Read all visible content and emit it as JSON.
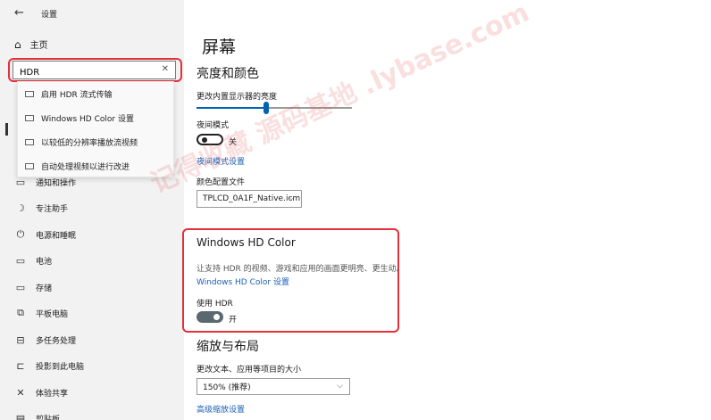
{
  "titlebar": {
    "back_icon": "back-arrow-icon",
    "title": "设置"
  },
  "sidebar": {
    "home_label": "主页",
    "search": {
      "value": "HDR",
      "clear_icon": "close-icon"
    },
    "suggestions": [
      {
        "label": "启用 HDR 流式传输"
      },
      {
        "label": "Windows HD Color 设置"
      },
      {
        "label": "以较低的分辨率播放流视频"
      },
      {
        "label": "自动处理视频以进行改进"
      }
    ],
    "items": [
      {
        "label": "通知和操作",
        "icon": "notification-icon"
      },
      {
        "label": "专注助手",
        "icon": "moon-icon"
      },
      {
        "label": "电源和睡眠",
        "icon": "power-icon"
      },
      {
        "label": "电池",
        "icon": "battery-icon"
      },
      {
        "label": "存储",
        "icon": "storage-icon"
      },
      {
        "label": "平板电脑",
        "icon": "tablet-icon"
      },
      {
        "label": "多任务处理",
        "icon": "multitask-icon"
      },
      {
        "label": "投影到此电脑",
        "icon": "project-icon"
      },
      {
        "label": "体验共享",
        "icon": "share-icon"
      },
      {
        "label": "剪贴板",
        "icon": "clipboard-icon"
      }
    ]
  },
  "main": {
    "title": "屏幕",
    "brightness": {
      "heading": "亮度和颜色",
      "slider_label": "更改内置显示器的亮度",
      "slider_level": 0.45,
      "night_label": "夜间模式",
      "night_state": "关",
      "night_link": "夜间模式设置",
      "profile_label": "颜色配置文件",
      "profile_value": "TPLCD_0A1F_Native.icm"
    },
    "hdcolor": {
      "heading": "Windows HD Color",
      "desc": "让支持 HDR 的视频、游戏和应用的画面更明亮、更生动。",
      "link": "Windows HD Color 设置",
      "hdr_label": "使用 HDR",
      "hdr_state": "开"
    },
    "scale": {
      "heading": "缩放与布局",
      "size_label": "更改文本、应用等项目的大小",
      "size_value": "150% (推荐)",
      "advanced_link": "高级缩放设置"
    }
  },
  "watermark": "记得收藏 源码基地 .lybase.com",
  "colors": {
    "accent": "#0063b1",
    "highlight": "#e5303b",
    "link": "#1a5fb4"
  }
}
